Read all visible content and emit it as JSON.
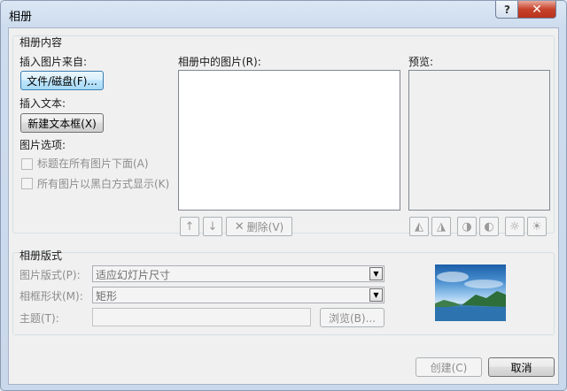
{
  "window": {
    "title": "相册",
    "help_glyph": "?",
    "close_glyph": "✕"
  },
  "album_content": {
    "group_label": "相册内容",
    "insert_from_label": "插入图片来自:",
    "file_disk_button": "文件/磁盘(F)...",
    "insert_text_label": "插入文本:",
    "new_textbox_button": "新建文本框(X)",
    "picture_options_label": "图片选项:",
    "option_captions": "标题在所有图片下面(A)",
    "option_bw": "所有图片以黑白方式显示(K)",
    "pictures_in_album_label": "相册中的图片(R):",
    "preview_label": "预览:",
    "delete_button": "删除(V)"
  },
  "album_layout": {
    "group_label": "相册版式",
    "picture_layout_label": "图片版式(P):",
    "picture_layout_value": "适应幻灯片尺寸",
    "frame_shape_label": "相框形状(M):",
    "frame_shape_value": "矩形",
    "theme_label": "主题(T):",
    "browse_button": "浏览(B)..."
  },
  "footer": {
    "create_button": "创建(C)",
    "cancel_button": "取消"
  },
  "icons": [
    "help-icon",
    "close-icon",
    "move-up-icon",
    "move-down-icon",
    "delete-x-icon",
    "rotate-left-icon",
    "rotate-right-icon",
    "contrast-up-icon",
    "contrast-down-icon",
    "brightness-up-icon",
    "brightness-down-icon",
    "combo-arrow-icon",
    "layout-preview-image"
  ]
}
